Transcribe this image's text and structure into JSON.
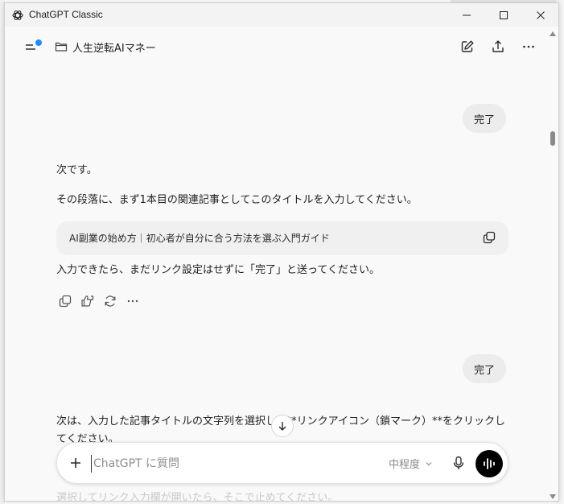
{
  "window": {
    "title": "ChatGPT Classic"
  },
  "header": {
    "project_name": "人生逆転AIマネー"
  },
  "messages": {
    "user_1": "完了",
    "assistant_1": {
      "line_1": "次です。",
      "line_2": "その段落に、まず1本目の関連記事としてこのタイトルを入力してください。",
      "code": "AI副業の始め方｜初心者が自分に合う方法を選ぶ入門ガイド",
      "line_3": "入力できたら、まだリンク設定はせずに「完了」と送ってください。"
    },
    "user_2": "完了",
    "assistant_2": {
      "line_1": "次は、入力した記事タイトルの文字列を選択して**リンクアイコン（鎖マーク）**をクリックしてください。",
      "line_2": "選択してリンク入力欄が開いたら、そこで止めてください。"
    }
  },
  "composer": {
    "placeholder": "ChatGPT に質問",
    "model_label": "中程度"
  },
  "colors": {
    "accent_dot": "#1a8cff",
    "voice_button": "#000000",
    "user_bubble": "#ececec"
  }
}
